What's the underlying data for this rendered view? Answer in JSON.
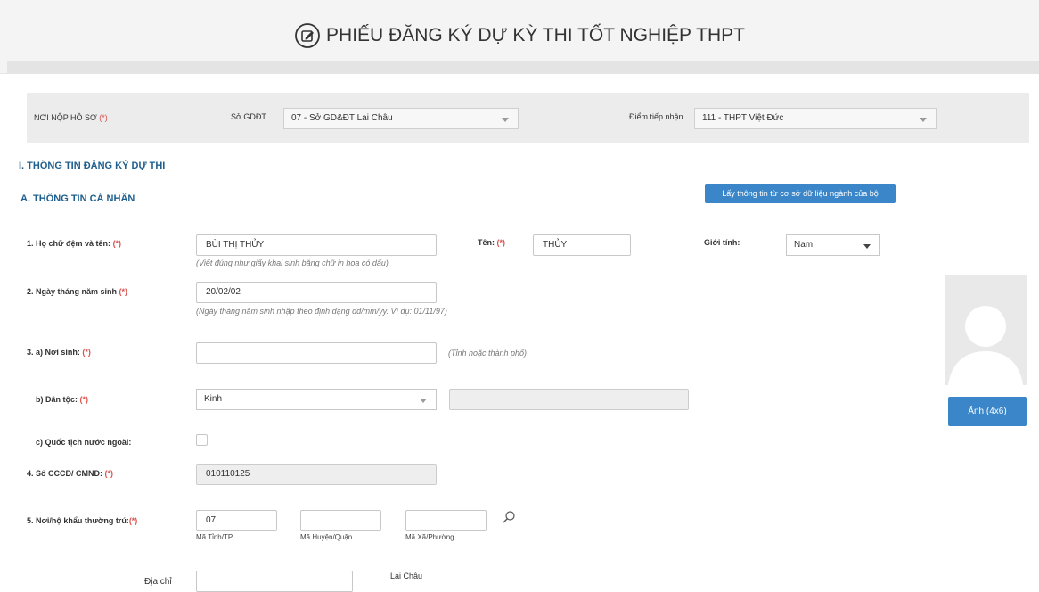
{
  "header": {
    "title": "PHIẾU ĐĂNG KÝ DỰ KỲ THI TỐT NGHIỆP THPT",
    "icon": "edit-square-icon"
  },
  "noi_nop": {
    "label": "NƠI NỘP HỒ SƠ",
    "req": "(*)",
    "so_label": "Sở GDĐT",
    "so_value": "07 - Sở GD&ĐT Lai Châu",
    "diem_label": "Điểm tiếp nhận",
    "diem_value": "111 - THPT Việt Đức"
  },
  "sections": {
    "s1": "I. THÔNG TIN ĐĂNG KÝ DỰ THI",
    "sA": "A. THÔNG TIN CÁ NHÂN",
    "fetch_button": "Lấy thông tin từ cơ sở dữ liệu ngành của bộ"
  },
  "fields": {
    "req": "(*)",
    "hoten_label": "1. Họ chữ đệm và tên:",
    "hoten_value": "BÙI THỊ THỦY",
    "hoten_hint": "(Viết đúng như giấy khai sinh bằng chữ in hoa có dấu)",
    "ten_label": "Tên:",
    "ten_value": "THỦY",
    "gioitinh_label": "Giới tính:",
    "gioitinh_value": "Nam",
    "ngaysinh_label": "2. Ngày tháng năm sinh",
    "ngaysinh_value": "20/02/02",
    "ngaysinh_hint": "(Ngày tháng năm sinh nhập theo định dạng dd/mm/yy. Ví dụ: 01/11/97)",
    "noisinh_label": "3. a) Nơi sinh:",
    "noisinh_value": "",
    "noisinh_hint": "(Tỉnh hoặc thành phố)",
    "dantoc_label": "b) Dân tộc:",
    "dantoc_value": "Kinh",
    "dantoc_other": "",
    "quoctich_label": "c) Quốc tịch nước ngoài:",
    "cccd_label": "4. Số CCCD/ CMND:",
    "cccd_value": "010110125",
    "hokhau_label": "5. Nơi/hộ khẩu thường trú:",
    "ma_tinh_value": "07",
    "ma_tinh_label": "Mã Tỉnh/TP",
    "ma_huyen_value": "",
    "ma_huyen_label": "Mã Huyện/Quận",
    "ma_xa_value": "",
    "ma_xa_label": "Mã Xã/Phường",
    "diachi_label": "Địa chỉ",
    "diachi_value": "",
    "tinh_text": "Lai Châu"
  },
  "photo": {
    "button": "Ảnh (4x6)",
    "icon": "avatar-placeholder-icon"
  },
  "colors": {
    "accent": "#3a86c8",
    "section": "#1f5f8f",
    "required": "#d9534f"
  }
}
